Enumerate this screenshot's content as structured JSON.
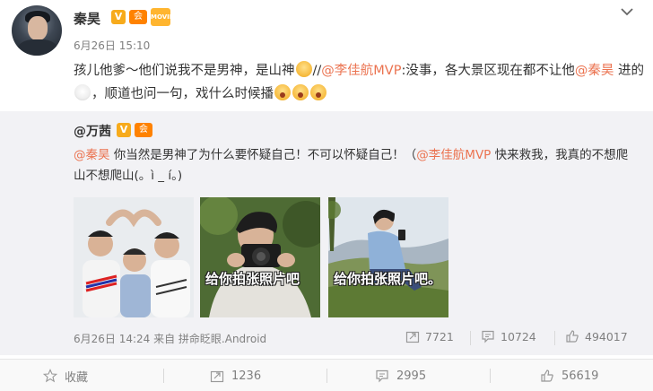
{
  "post": {
    "username": "秦昊",
    "verified_badge": "V",
    "member_badge": "会",
    "movie_badge": "MOVIE",
    "time": "6月26日 15:10",
    "text_parts": {
      "p1": "孩儿他爹～他们说我不是男神，是山神",
      "p2": "//",
      "mention1": "@李佳航MVP",
      "p3": ":没事，各大景区现在都不让他",
      "mention2": "@秦昊",
      "p4": " 进的",
      "p5": "，顺道也问一句，戏什么时候播"
    }
  },
  "repost": {
    "username": "@万茜",
    "verified_badge": "V",
    "member_badge": "会",
    "text_parts": {
      "mention1": "@秦昊",
      "p1": " 你当然是男神了为什么要怀疑自己！不可以怀疑自己！（",
      "mention2": "@李佳航MVP",
      "p2": " 快来救我，我真的不想爬山不想爬山(。ì _ í。)"
    },
    "photos": [
      {
        "caption": ""
      },
      {
        "caption": "给你拍张照片吧"
      },
      {
        "caption": "给你拍张照片吧。"
      }
    ],
    "meta": "6月26日 14:24 来自 拼命眨眼.Android",
    "forwards": "7721",
    "comments": "10724",
    "likes": "494017"
  },
  "footer": {
    "favorite_label": "收藏",
    "forward_count": "1236",
    "comment_count": "2995",
    "like_count": "56619"
  },
  "colors": {
    "mention": "#eb7350",
    "muted": "#808080",
    "repost_bg": "#f2f2f5"
  },
  "icons": [
    "menu-icon",
    "star-icon",
    "forward-icon",
    "comment-icon",
    "like-icon",
    "emoji-icon"
  ]
}
